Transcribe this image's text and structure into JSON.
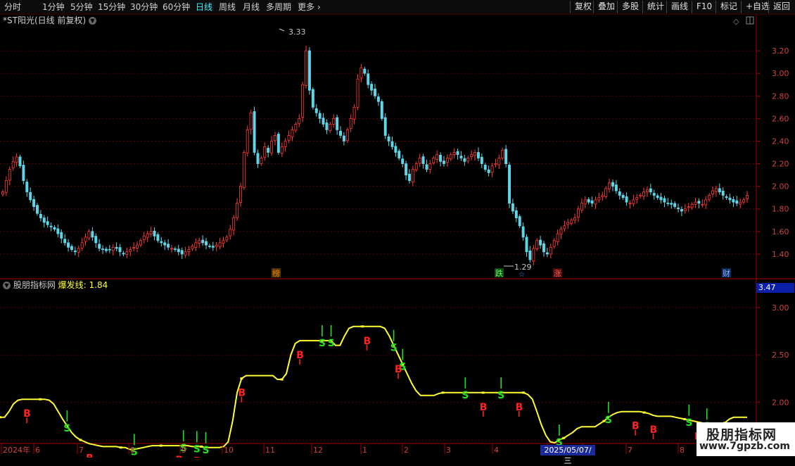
{
  "toolbar": {
    "left_items": [
      "分时",
      "1分钟",
      "5分钟",
      "15分钟",
      "30分钟",
      "60分钟",
      "日线",
      "周线",
      "月线",
      "多周期",
      "更多"
    ],
    "active_index": 6,
    "right_items": [
      "复权",
      "叠加",
      "多股",
      "统计",
      "画线",
      "F10",
      "标记",
      "+自选",
      "返回"
    ]
  },
  "chart_header": {
    "stock_title": "*ST阳光(日线 前复权)",
    "indicator_name": "股朋指标网",
    "indicator_line_label": "爆发线:",
    "indicator_line_value": "1.84",
    "current_price_box": "3.47"
  },
  "markers": {
    "high_label": "3.33",
    "low_label": "1.29",
    "event_tags": [
      {
        "text": "榜",
        "color": "#e08a00"
      },
      {
        "text": "跌",
        "color": "#2aa82a"
      },
      {
        "text": "☆",
        "color": "#3aa0ff"
      },
      {
        "text": "涨",
        "color": "#d02020"
      },
      {
        "text": "财",
        "color": "#2a6fd0"
      }
    ]
  },
  "x_axis": {
    "labels": [
      "2024年",
      "6",
      "7",
      "8",
      "9",
      "10",
      "11",
      "12",
      "1",
      "2",
      "3",
      "4",
      "5",
      "6",
      "7",
      "8"
    ],
    "crosshair_date": "2025/05/07/三"
  },
  "watermark": {
    "title": "股朋指标网",
    "url": "www.7gpzb.com"
  },
  "colors": {
    "up": "#ff3b3b",
    "down": "#5fd6e8",
    "line": "#ffff33",
    "buy": "#ff2222",
    "sell": "#22e022",
    "grid": "#5a0000",
    "axis": "#aa0000"
  },
  "chart_data": [
    {
      "type": "candlestick",
      "ylim": [
        1.25,
        3.4
      ],
      "y_ticks": [
        1.4,
        1.6,
        1.8,
        2.0,
        2.2,
        2.4,
        2.6,
        2.8,
        3.0,
        3.2
      ],
      "close": [
        1.95,
        2.05,
        2.15,
        2.22,
        2.26,
        2.18,
        2.05,
        1.95,
        1.88,
        1.82,
        1.76,
        1.72,
        1.68,
        1.66,
        1.64,
        1.62,
        1.58,
        1.54,
        1.5,
        1.46,
        1.44,
        1.42,
        1.45,
        1.5,
        1.55,
        1.6,
        1.55,
        1.5,
        1.45,
        1.44,
        1.43,
        1.44,
        1.46,
        1.45,
        1.42,
        1.4,
        1.42,
        1.44,
        1.46,
        1.48,
        1.52,
        1.56,
        1.58,
        1.6,
        1.56,
        1.52,
        1.5,
        1.48,
        1.46,
        1.45,
        1.44,
        1.42,
        1.4,
        1.42,
        1.44,
        1.47,
        1.5,
        1.52,
        1.5,
        1.48,
        1.47,
        1.46,
        1.48,
        1.5,
        1.52,
        1.55,
        1.62,
        1.72,
        1.85,
        2.0,
        2.3,
        2.5,
        2.65,
        2.3,
        2.2,
        2.25,
        2.35,
        2.3,
        2.4,
        2.45,
        2.3,
        2.35,
        2.4,
        2.45,
        2.5,
        2.55,
        2.6,
        2.9,
        3.2,
        2.85,
        2.7,
        2.65,
        2.6,
        2.55,
        2.5,
        2.55,
        2.6,
        2.5,
        2.45,
        2.4,
        2.5,
        2.6,
        2.7,
        2.95,
        3.05,
        3.0,
        2.9,
        2.85,
        2.8,
        2.75,
        2.6,
        2.45,
        2.4,
        2.35,
        2.3,
        2.25,
        2.2,
        2.1,
        2.05,
        2.15,
        2.2,
        2.25,
        2.2,
        2.15,
        2.2,
        2.25,
        2.28,
        2.22,
        2.2,
        2.25,
        2.28,
        2.3,
        2.28,
        2.25,
        2.22,
        2.25,
        2.28,
        2.3,
        2.25,
        2.2,
        2.15,
        2.12,
        2.18,
        2.2,
        2.25,
        2.32,
        2.2,
        1.85,
        1.78,
        1.72,
        1.65,
        1.55,
        1.42,
        1.35,
        1.45,
        1.52,
        1.48,
        1.42,
        1.4,
        1.46,
        1.52,
        1.58,
        1.62,
        1.65,
        1.68,
        1.7,
        1.72,
        1.8,
        1.85,
        1.88,
        1.86,
        1.85,
        1.88,
        1.9,
        1.92,
        1.98,
        2.03,
        2.0,
        1.96,
        1.92,
        1.9,
        1.86,
        1.85,
        1.88,
        1.9,
        1.92,
        1.95,
        1.97,
        1.95,
        1.92,
        1.9,
        1.88,
        1.86,
        1.85,
        1.84,
        1.82,
        1.8,
        1.78,
        1.8,
        1.82,
        1.84,
        1.86,
        1.85,
        1.84,
        1.88,
        1.92,
        1.96,
        1.98,
        1.95,
        1.92,
        1.9,
        1.88,
        1.86,
        1.85,
        1.86,
        1.88,
        1.92
      ]
    },
    {
      "type": "line",
      "name": "爆发线",
      "ylim": [
        1.6,
        3.2
      ],
      "y_ticks": [
        1.6,
        2.0,
        2.5,
        3.0
      ],
      "values": [
        1.84,
        1.84,
        1.9,
        1.98,
        2.02,
        2.03,
        2.03,
        2.03,
        2.03,
        2.03,
        2.03,
        2.02,
        1.98,
        1.9,
        1.82,
        1.75,
        1.68,
        1.63,
        1.6,
        1.58,
        1.56,
        1.55,
        1.54,
        1.53,
        1.53,
        1.53,
        1.53,
        1.52,
        1.52,
        1.5,
        1.5,
        1.51,
        1.52,
        1.53,
        1.54,
        1.54,
        1.54,
        1.54,
        1.54,
        1.54,
        1.54,
        1.54,
        1.54,
        1.53,
        1.53,
        1.53,
        1.52,
        1.52,
        1.52,
        1.52,
        1.53,
        1.58,
        1.8,
        2.1,
        2.25,
        2.28,
        2.28,
        2.28,
        2.28,
        2.28,
        2.28,
        2.28,
        2.24,
        2.24,
        2.3,
        2.5,
        2.62,
        2.65,
        2.65,
        2.65,
        2.65,
        2.65,
        2.65,
        2.65,
        2.65,
        2.6,
        2.6,
        2.7,
        2.78,
        2.8,
        2.8,
        2.8,
        2.8,
        2.8,
        2.8,
        2.8,
        2.78,
        2.7,
        2.6,
        2.5,
        2.4,
        2.3,
        2.2,
        2.12,
        2.07,
        2.07,
        2.07,
        2.07,
        2.09,
        2.1,
        2.1,
        2.1,
        2.1,
        2.1,
        2.1,
        2.1,
        2.1,
        2.1,
        2.1,
        2.1,
        2.1,
        2.1,
        2.1,
        2.1,
        2.1,
        2.1,
        2.1,
        2.1,
        2.08,
        2.03,
        1.9,
        1.76,
        1.65,
        1.58,
        1.57,
        1.6,
        1.62,
        1.65,
        1.68,
        1.72,
        1.74,
        1.74,
        1.74,
        1.74,
        1.77,
        1.8,
        1.84,
        1.87,
        1.89,
        1.9,
        1.9,
        1.9,
        1.9,
        1.9,
        1.89,
        1.88,
        1.86,
        1.85,
        1.85,
        1.85,
        1.85,
        1.84,
        1.83,
        1.82,
        1.81,
        1.8,
        1.79,
        1.78,
        1.77,
        1.76,
        1.76,
        1.76,
        1.78,
        1.82,
        1.84,
        1.84,
        1.84,
        1.84
      ],
      "buy_signals": [
        15,
        30,
        41,
        44,
        46,
        72,
        74,
        88,
        90,
        104,
        112,
        125,
        136,
        154,
        158
      ],
      "sell_signals": [
        6,
        20,
        40,
        44,
        54,
        67,
        82,
        89,
        108,
        116,
        142,
        146,
        156
      ]
    }
  ]
}
